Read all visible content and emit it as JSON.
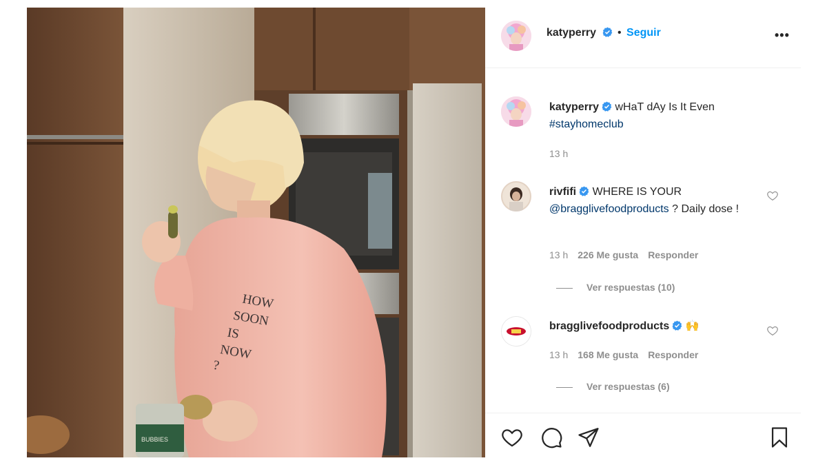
{
  "post": {
    "author": "katyperry",
    "follow_label": "Seguir",
    "separator": "•",
    "more_label": "•••"
  },
  "caption": {
    "author": "katyperry",
    "text": "wHaT dAy Is It Even",
    "hashtag": "#stayhomeclub",
    "time": "13 h"
  },
  "comments": [
    {
      "author": "rivfifi",
      "text_before": "WHERE IS YOUR",
      "mention": "@bragglivefoodproducts",
      "text_after": "? Daily dose !",
      "time": "13 h",
      "likes": "226 Me gusta",
      "reply_label": "Responder",
      "view_replies": "Ver respuestas (10)"
    },
    {
      "author": "bragglivefoodproducts",
      "emoji": "🙌",
      "time": "13 h",
      "likes": "168 Me gusta",
      "reply_label": "Responder",
      "view_replies": "Ver respuestas (6)"
    }
  ],
  "photo": {
    "shirt_text": [
      "HOW",
      "SOON",
      "IS",
      "NOW",
      "?"
    ],
    "jar_label": "BUBBIES"
  },
  "icons": {
    "like": "heart-icon",
    "comment": "comment-icon",
    "share": "share-icon",
    "save": "bookmark-icon",
    "verified": "verified-badge-icon"
  },
  "colors": {
    "follow": "#0095f6",
    "verified": "#3897f0",
    "link": "#00376b",
    "muted": "#8e8e8e"
  }
}
